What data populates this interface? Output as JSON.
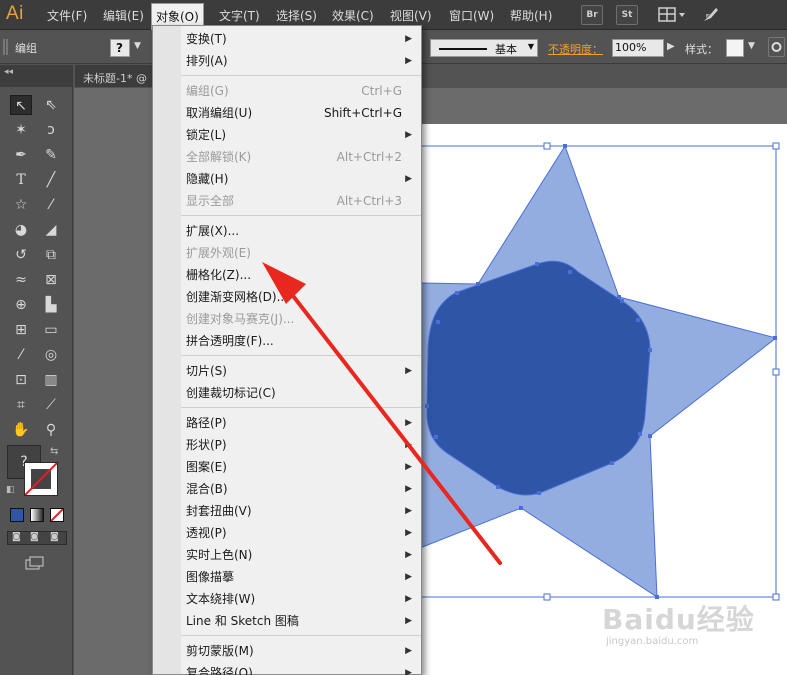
{
  "app": {
    "logo": "Ai"
  },
  "menubar": [
    {
      "label": "文件(F)",
      "active": false
    },
    {
      "label": "编辑(E)",
      "active": false
    },
    {
      "label": "对象(O)",
      "active": true
    },
    {
      "label": "文字(T)",
      "active": false
    },
    {
      "label": "选择(S)",
      "active": false
    },
    {
      "label": "效果(C)",
      "active": false
    },
    {
      "label": "视图(V)",
      "active": false
    },
    {
      "label": "窗口(W)",
      "active": false
    },
    {
      "label": "帮助(H)",
      "active": false
    }
  ],
  "toolbar_buttons": {
    "bridge": "Br",
    "stock": "St"
  },
  "controlbar": {
    "selection_label": "编组",
    "stroke_style": "基本",
    "opacity_label": "不透明度：",
    "opacity_value": "100%",
    "style_label": "样式："
  },
  "document": {
    "tab_title": "未标题-1* @"
  },
  "object_menu": {
    "groups": [
      [
        {
          "label": "变换(T)",
          "shortcut": "",
          "submenu": true,
          "disabled": false
        },
        {
          "label": "排列(A)",
          "shortcut": "",
          "submenu": true,
          "disabled": false
        }
      ],
      [
        {
          "label": "编组(G)",
          "shortcut": "Ctrl+G",
          "submenu": false,
          "disabled": true
        },
        {
          "label": "取消编组(U)",
          "shortcut": "Shift+Ctrl+G",
          "submenu": false,
          "disabled": false
        },
        {
          "label": "锁定(L)",
          "shortcut": "",
          "submenu": true,
          "disabled": false
        },
        {
          "label": "全部解锁(K)",
          "shortcut": "Alt+Ctrl+2",
          "submenu": false,
          "disabled": true
        },
        {
          "label": "隐藏(H)",
          "shortcut": "",
          "submenu": true,
          "disabled": false
        },
        {
          "label": "显示全部",
          "shortcut": "Alt+Ctrl+3",
          "submenu": false,
          "disabled": true
        }
      ],
      [
        {
          "label": "扩展(X)...",
          "shortcut": "",
          "submenu": false,
          "disabled": false
        },
        {
          "label": "扩展外观(E)",
          "shortcut": "",
          "submenu": false,
          "disabled": true
        },
        {
          "label": "栅格化(Z)...",
          "shortcut": "",
          "submenu": false,
          "disabled": false
        },
        {
          "label": "创建渐变网格(D)...",
          "shortcut": "",
          "submenu": false,
          "disabled": false
        },
        {
          "label": "创建对象马赛克(J)...",
          "shortcut": "",
          "submenu": false,
          "disabled": true
        },
        {
          "label": "拼合透明度(F)...",
          "shortcut": "",
          "submenu": false,
          "disabled": false
        }
      ],
      [
        {
          "label": "切片(S)",
          "shortcut": "",
          "submenu": true,
          "disabled": false
        },
        {
          "label": "创建裁切标记(C)",
          "shortcut": "",
          "submenu": false,
          "disabled": false
        }
      ],
      [
        {
          "label": "路径(P)",
          "shortcut": "",
          "submenu": true,
          "disabled": false
        },
        {
          "label": "形状(P)",
          "shortcut": "",
          "submenu": true,
          "disabled": false
        },
        {
          "label": "图案(E)",
          "shortcut": "",
          "submenu": true,
          "disabled": false
        },
        {
          "label": "混合(B)",
          "shortcut": "",
          "submenu": true,
          "disabled": false
        },
        {
          "label": "封套扭曲(V)",
          "shortcut": "",
          "submenu": true,
          "disabled": false
        },
        {
          "label": "透视(P)",
          "shortcut": "",
          "submenu": true,
          "disabled": false
        },
        {
          "label": "实时上色(N)",
          "shortcut": "",
          "submenu": true,
          "disabled": false
        },
        {
          "label": "图像描摹",
          "shortcut": "",
          "submenu": true,
          "disabled": false
        },
        {
          "label": "文本绕排(W)",
          "shortcut": "",
          "submenu": true,
          "disabled": false
        },
        {
          "label": "Line 和 Sketch 图稿",
          "shortcut": "",
          "submenu": true,
          "disabled": false
        }
      ],
      [
        {
          "label": "剪切蒙版(M)",
          "shortcut": "",
          "submenu": true,
          "disabled": false
        },
        {
          "label": "复合路径(O)",
          "shortcut": "",
          "submenu": true,
          "disabled": false
        }
      ]
    ]
  },
  "colors": {
    "star_fill": "#94ade0",
    "hexagon_fill": "#2e55a6",
    "selection": "#4a6fd8",
    "annotation_arrow": "#e8281e",
    "logo": "#e8a23a"
  },
  "watermark": {
    "main": "Baidu经验",
    "sub": "jingyan.baidu.com"
  }
}
